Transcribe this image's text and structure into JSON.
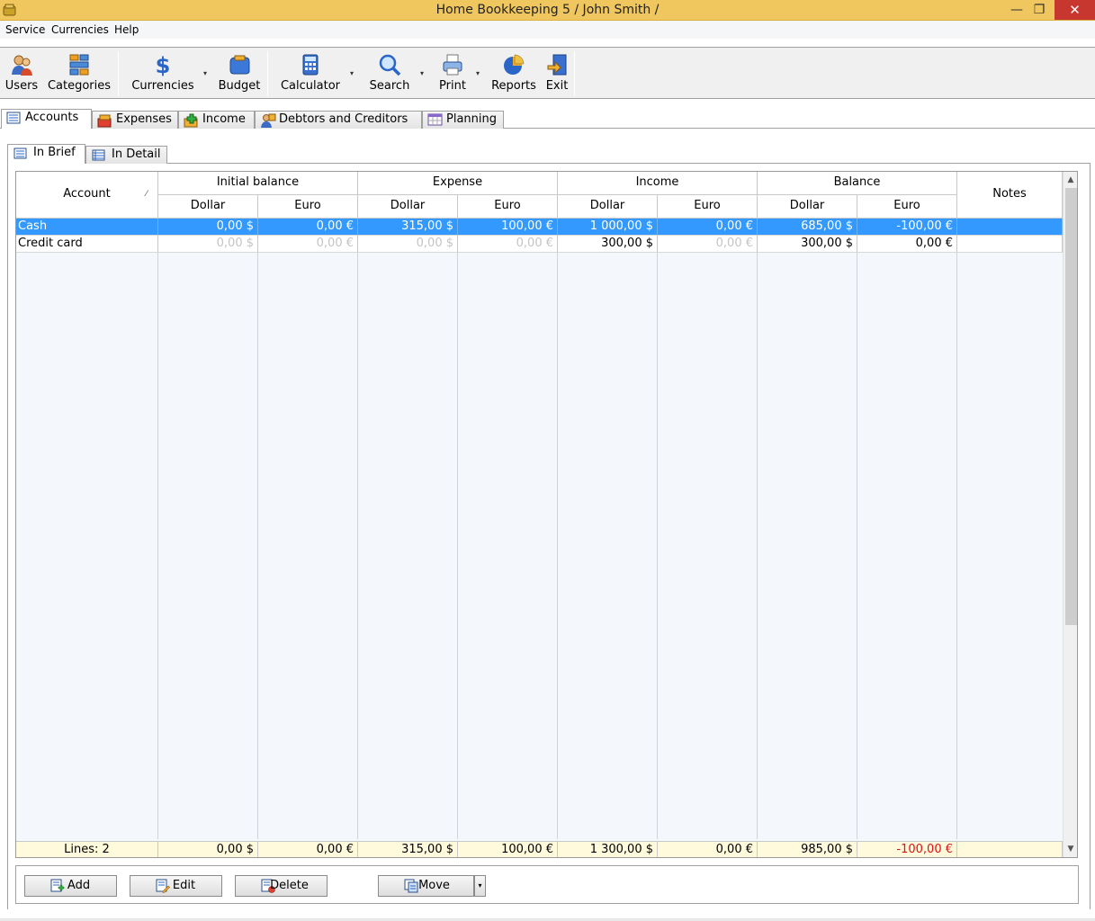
{
  "window": {
    "title": "Home Bookkeeping 5  / John Smith /",
    "minimize": "—",
    "maximize": "❐",
    "close": "✕"
  },
  "menu": {
    "items": [
      "Service",
      "Currencies",
      "Help"
    ]
  },
  "toolbar": {
    "users": "Users",
    "categories": "Categories",
    "currencies": "Currencies",
    "budget": "Budget",
    "calculator": "Calculator",
    "search": "Search",
    "print": "Print",
    "reports": "Reports",
    "exit": "Exit",
    "dropdown_glyph": "▾"
  },
  "tabs": [
    "Accounts",
    "Expenses",
    "Income",
    "Debtors and Creditors",
    "Planning"
  ],
  "active_tab": "Accounts",
  "subtabs": [
    "In Brief",
    "In Detail"
  ],
  "active_subtab": "In Brief",
  "grid": {
    "header": {
      "account": "Account",
      "sort_glyph": "⁄",
      "groups": [
        "Initial balance",
        "Expense",
        "Income",
        "Balance"
      ],
      "currencies": [
        "Dollar",
        "Euro"
      ],
      "notes": "Notes"
    },
    "rows": [
      {
        "account": "Cash",
        "values": [
          "0,00 $",
          "0,00 €",
          "315,00 $",
          "100,00 €",
          "1 000,00 $",
          "0,00 €",
          "685,00 $",
          "-100,00 €"
        ],
        "notes": "",
        "selected": true,
        "dim": [
          false,
          false,
          false,
          false,
          false,
          false,
          false,
          false
        ]
      },
      {
        "account": "Credit card",
        "values": [
          "0,00 $",
          "0,00 €",
          "0,00 $",
          "0,00 €",
          "300,00 $",
          "0,00 €",
          "300,00 $",
          "0,00 €"
        ],
        "notes": "",
        "selected": false,
        "dim": [
          true,
          true,
          true,
          true,
          false,
          true,
          false,
          false
        ]
      }
    ],
    "footer": {
      "lines": "Lines: 2",
      "values": [
        "0,00 $",
        "0,00 €",
        "315,00 $",
        "100,00 €",
        "1 300,00 $",
        "0,00 €",
        "985,00 $",
        "-100,00 €"
      ],
      "negative_color": "#e01010"
    }
  },
  "buttons": {
    "add": "Add",
    "edit": "Edit",
    "delete": "Delete",
    "move": "Move"
  },
  "colors": {
    "title_bar": "#f0c75e",
    "selection": "#3399ff",
    "footer_bg": "#fffadc",
    "close_button": "#c7372f"
  }
}
